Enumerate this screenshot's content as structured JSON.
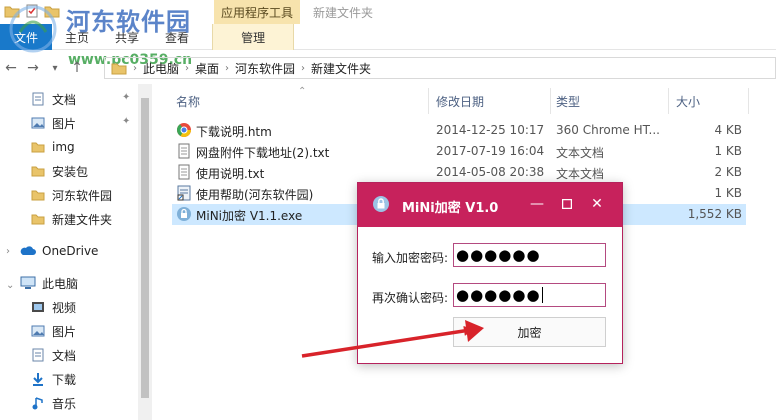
{
  "ribbon": {
    "context_tab_title": "应用程序工具",
    "window_title": "新建文件夹",
    "tabs": [
      "文件",
      "主页",
      "共享",
      "查看"
    ],
    "manage_tab": "管理"
  },
  "watermark": {
    "brand": "河东软件园",
    "url": "www.pc0359.cn"
  },
  "address": {
    "crumbs": [
      "此电脑",
      "桌面",
      "河东软件园",
      "新建文件夹"
    ]
  },
  "sidebar": {
    "quick": [
      "文档",
      "图片",
      "img",
      "安装包",
      "河东软件园",
      "新建文件夹"
    ],
    "onedrive": "OneDrive",
    "this_pc": "此电脑",
    "pc_items": [
      "视频",
      "图片",
      "文档",
      "下载",
      "音乐"
    ]
  },
  "columns": {
    "name": "名称",
    "date": "修改日期",
    "type": "类型",
    "size": "大小"
  },
  "files": [
    {
      "name": "下载说明.htm",
      "date": "2014-12-25 10:17",
      "type": "360 Chrome HT...",
      "size": "4 KB",
      "icon": "chrome-icon"
    },
    {
      "name": "网盘附件下载地址(2).txt",
      "date": "2017-07-19 16:04",
      "type": "文本文档",
      "size": "1 KB",
      "icon": "text-file-icon"
    },
    {
      "name": "使用说明.txt",
      "date": "2014-05-08 20:38",
      "type": "文本文档",
      "size": "2 KB",
      "icon": "text-file-icon"
    },
    {
      "name": "使用帮助(河东软件园)",
      "date": "",
      "type": "建方式",
      "size": "1 KB",
      "icon": "shortcut-icon"
    },
    {
      "name": "MiNi加密 V1.1.exe",
      "date": "",
      "type": "",
      "size": "1,552 KB",
      "icon": "lock-app-icon"
    }
  ],
  "dialog": {
    "title": "MiNi加密 V1.0",
    "label_password": "输入加密密码:",
    "label_confirm": "再次确认密码:",
    "password_value": "●●●●●●",
    "confirm_value": "●●●●●●",
    "button": "加密",
    "accent": "#c7225c"
  }
}
